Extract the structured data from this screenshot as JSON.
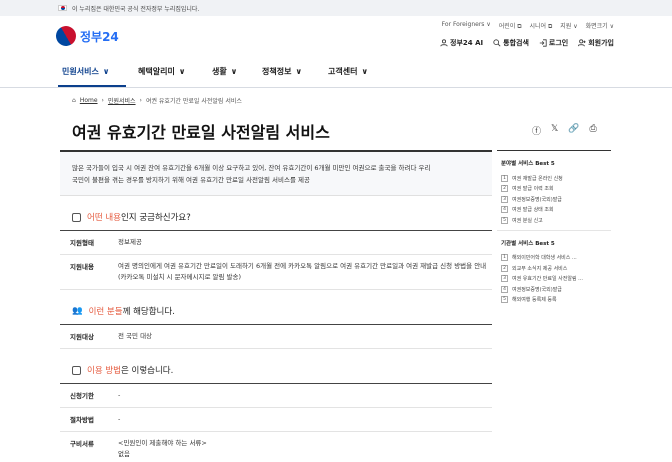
{
  "govbar": {
    "notice": "이 누리집은 대한민국 공식 전자정부 누리집입니다."
  },
  "header": {
    "logo_text": "정부24",
    "util_top": [
      "For Foreigners ∨",
      "어린이 ⧉",
      "시니어 ⧉",
      "지원 ∨",
      "화면크기 ∨"
    ],
    "util_bottom": [
      {
        "icon": "user-icon",
        "label": "정부24 AI"
      },
      {
        "icon": "search-icon",
        "label": "통합검색"
      },
      {
        "icon": "login-icon",
        "label": "로그인"
      },
      {
        "icon": "user-plus-icon",
        "label": "회원가입"
      }
    ]
  },
  "nav": {
    "items": [
      "민원서비스",
      "혜택알리미",
      "생활",
      "정책정보",
      "고객센터"
    ]
  },
  "breadcrumb": {
    "home": "Home",
    "level1": "민원서비스",
    "current": "여권 유효기간 만료일 사전알림 서비스"
  },
  "page": {
    "title": "여권 유효기간 만료일 사전알림 서비스",
    "intro_line1": "많은 국가들이 입국 시 여권 잔여 유효기간을 6개월 이상 요구하고 있어, 잔여 유효기간이 6개월 미만인 여권으로 출국을 하려다 우리",
    "intro_line2": "국민이 불편을 겪는 경우를 방지하기 위해 여권 유효기간 만료일 사전알림 서비스를 제공"
  },
  "section1": {
    "head_hl": "어떤 내용",
    "head_rest": "인지 궁금하신가요?",
    "rows": [
      {
        "k": "지원형태",
        "v": "정보제공"
      },
      {
        "k": "지원내용",
        "v": "여권 명의인에게 여권 유효기간 만료일이 도래하기 6개월 전에 카카오톡 알림으로 여권 유효기간 만료일과 여권 재발급 신청 방법을 안내",
        "v2": "(카카오톡 미설치 시 문자메시지로 알림 발송)"
      }
    ]
  },
  "section2": {
    "head_hl": "이런 분들",
    "head_rest": "께 해당합니다.",
    "rows": [
      {
        "k": "지원대상",
        "v": "전 국민 대상"
      }
    ]
  },
  "section3": {
    "head_hl": "이용 방법",
    "head_rest": "은 이렇습니다.",
    "rows": [
      {
        "k": "신청기한",
        "v": "-"
      },
      {
        "k": "절차방법",
        "v": "-"
      },
      {
        "k": "구비서류",
        "v": "<민원인이 제출해야 하는 서류>",
        "v2": "없음"
      }
    ]
  },
  "sidebar": {
    "best1_title": "분야별 서비스 Best 5",
    "best1": [
      "여권 재발급 온라인 신청",
      "여권 발급 이력 조회",
      "여권정보증명(국외)발급",
      "여권 발급 상태 조회",
      "여권 분실 신고"
    ],
    "best2_title": "기관별 서비스 Best 5",
    "best2": [
      "해외이민어학 대학생 서비스 ...",
      "외교부 소식지 제공 서비스",
      "여권 유효기간 만료일 사전알림 ...",
      "여권정보증명(국외)발급",
      "해외여행 등록제 등록"
    ]
  }
}
